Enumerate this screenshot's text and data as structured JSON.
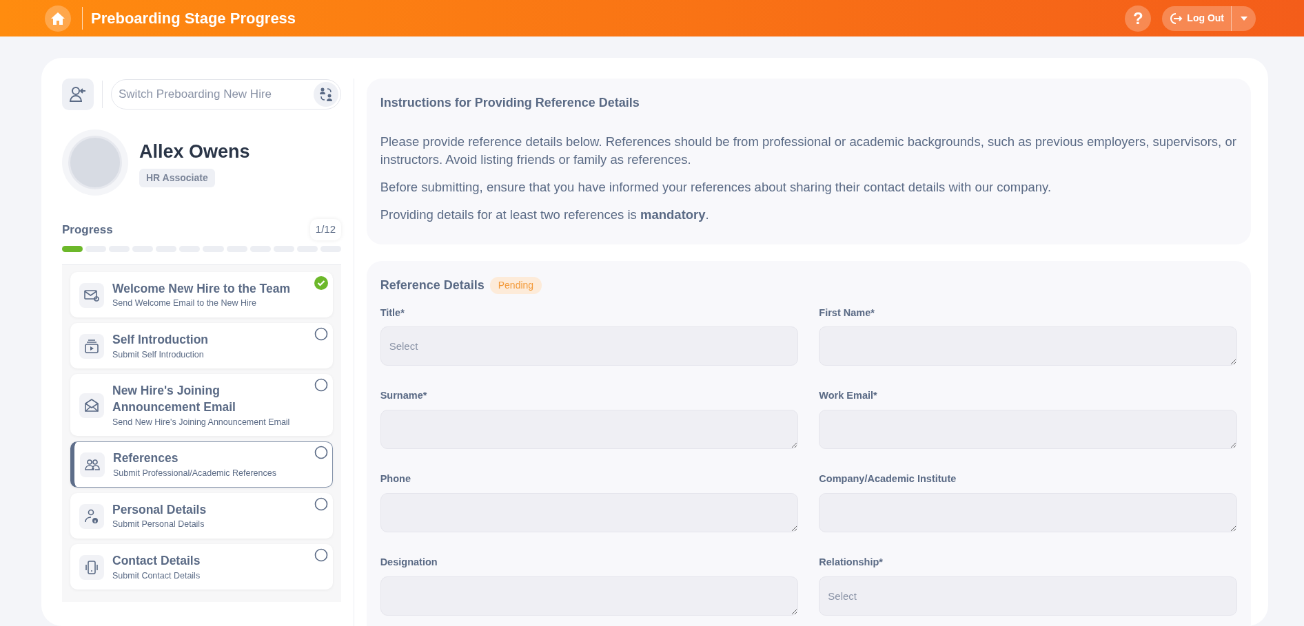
{
  "header": {
    "title": "Preboarding Stage Progress",
    "help": "?",
    "logout": "Log Out"
  },
  "switcher": {
    "placeholder": "Switch Preboarding New Hire"
  },
  "profile": {
    "name": "Allex Owens",
    "role": "HR Associate"
  },
  "progress": {
    "label": "Progress",
    "count": "1/12",
    "segments": [
      {
        "done": true
      },
      {
        "done": false
      },
      {
        "done": false
      },
      {
        "done": false
      },
      {
        "done": false
      },
      {
        "done": false
      },
      {
        "done": false
      },
      {
        "done": false
      },
      {
        "done": false
      },
      {
        "done": false
      },
      {
        "done": false
      },
      {
        "done": false
      }
    ]
  },
  "steps": [
    {
      "kind": "email",
      "title": "Welcome New Hire to the Team",
      "subtitle": "Send Welcome Email to the New Hire",
      "completed": true,
      "selected": false
    },
    {
      "kind": "video",
      "title": "Self Introduction",
      "subtitle": "Submit Self Introduction",
      "completed": false,
      "selected": false
    },
    {
      "kind": "envelope",
      "title": "New Hire's Joining Announcement Email",
      "subtitle": "Send New Hire's Joining Announcement Email",
      "completed": false,
      "selected": false
    },
    {
      "kind": "people",
      "title": "References",
      "subtitle": "Submit Professional/Academic References",
      "completed": false,
      "selected": true
    },
    {
      "kind": "person",
      "title": "Personal Details",
      "subtitle": "Submit Personal Details",
      "completed": false,
      "selected": false
    },
    {
      "kind": "phone",
      "title": "Contact Details",
      "subtitle": "Submit Contact Details",
      "completed": false,
      "selected": false
    }
  ],
  "instructions": {
    "title": "Instructions for Providing Reference Details",
    "paragraphs": [
      "Please provide reference details below. References should be from professional or academic backgrounds, such as previous employers, supervisors, or instructors. Avoid listing friends or family as references.",
      "Before submitting, ensure that you have informed your references about sharing their contact details with our company.",
      "Providing details for at least two references is **mandatory**."
    ]
  },
  "reference_details": {
    "title": "Reference Details",
    "status": "Pending",
    "fields": [
      {
        "kind": "select",
        "label": "Title*",
        "placeholder": "Select"
      },
      {
        "kind": "text",
        "label": "First Name*"
      },
      {
        "kind": "text",
        "label": "Surname*"
      },
      {
        "kind": "text",
        "label": "Work Email*"
      },
      {
        "kind": "text",
        "label": "Phone"
      },
      {
        "kind": "text",
        "label": "Company/Academic Institute"
      },
      {
        "kind": "text",
        "label": "Designation"
      },
      {
        "kind": "select",
        "label": "Relationship*",
        "placeholder": "Select"
      }
    ]
  }
}
